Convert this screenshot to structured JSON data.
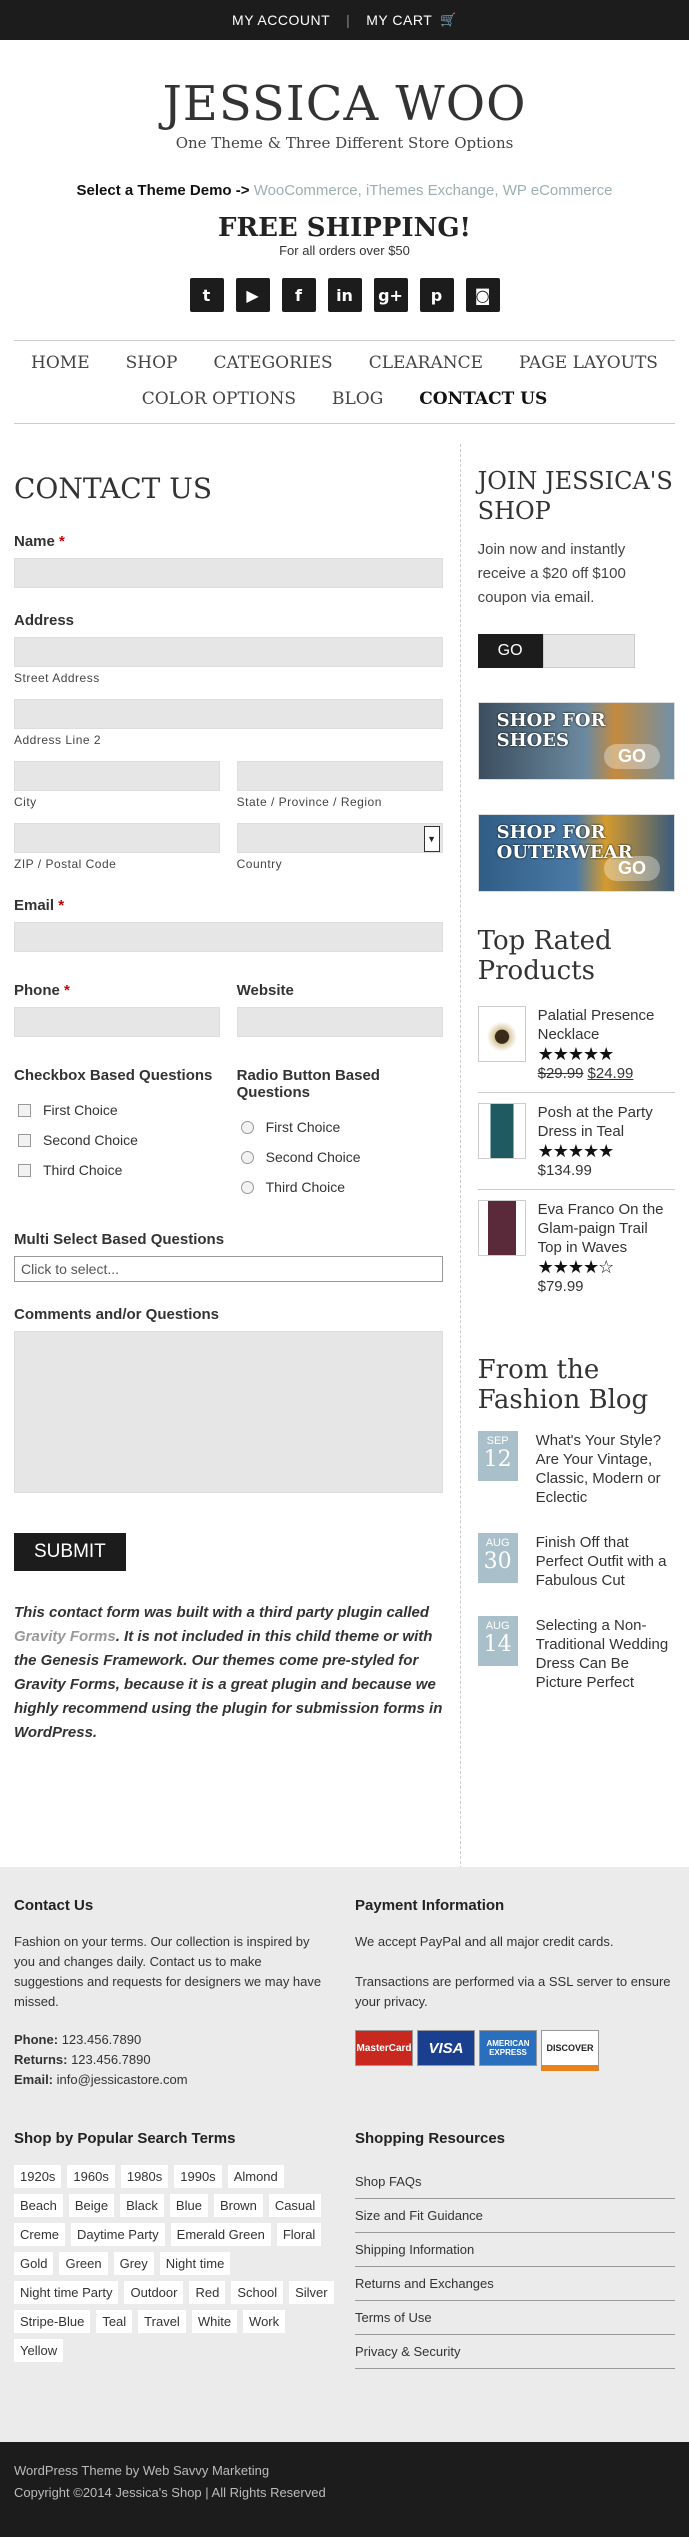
{
  "topbar": {
    "account": "MY ACCOUNT",
    "cart": "MY CART"
  },
  "header": {
    "title": "JESSICA WOO",
    "tagline": "One Theme & Three Different Store Options",
    "demo_label": "Select a Theme Demo ->",
    "demo_links": [
      "WooCommerce",
      "iThemes Exchange",
      "WP eCommerce"
    ],
    "shipping_title": "FREE SHIPPING!",
    "shipping_sub": "For all orders over $50",
    "social": [
      "twitter-icon",
      "youtube-icon",
      "facebook-icon",
      "linkedin-icon",
      "googleplus-icon",
      "pinterest-icon",
      "instagram-icon"
    ]
  },
  "nav": {
    "row1": [
      "HOME",
      "SHOP",
      "CATEGORIES",
      "CLEARANCE",
      "PAGE LAYOUTS"
    ],
    "row2": [
      "COLOR OPTIONS",
      "BLOG",
      "CONTACT US"
    ]
  },
  "form": {
    "title": "CONTACT US",
    "name_label": "Name",
    "address_label": "Address",
    "street": "Street Address",
    "line2": "Address Line 2",
    "city": "City",
    "state": "State / Province / Region",
    "zip": "ZIP / Postal Code",
    "country": "Country",
    "email_label": "Email",
    "phone_label": "Phone",
    "website_label": "Website",
    "checkbox_label": "Checkbox Based Questions",
    "checkbox_choices": [
      "First Choice",
      "Second Choice",
      "Third Choice"
    ],
    "radio_label": "Radio Button Based Questions",
    "radio_choices": [
      "First Choice",
      "Second Choice",
      "Third Choice"
    ],
    "multi_label": "Multi Select Based Questions",
    "multi_placeholder": "Click to select...",
    "comments_label": "Comments and/or Questions",
    "submit": "SUBMIT",
    "note_a": "This contact form was built with a third party plugin called ",
    "note_link": "Gravity Forms",
    "note_b": ".  It is not included in this child theme or with the Genesis Framework. Our themes come pre-styled for Gravity Forms, because it is a great plugin and because we highly recommend using the plugin for submission forms in WordPress."
  },
  "sidebar": {
    "join_title": "JOIN JESSICA'S SHOP",
    "join_text": "Join now and instantly receive a $20 off $100 coupon via email.",
    "go": "GO",
    "promo1": "SHOP FOR SHOES",
    "promo2": "SHOP FOR OUTERWEAR",
    "promo_go": "GO",
    "top_title": "Top Rated Products",
    "products": [
      {
        "name": "Palatial Presence Necklace",
        "stars": "★★★★★",
        "old_price": "$29.99",
        "price": "$24.99"
      },
      {
        "name": "Posh at the Party Dress in Teal",
        "stars": "★★★★★",
        "price": "$134.99"
      },
      {
        "name": "Eva Franco On the Glam-paign Trail Top in Waves",
        "stars": "★★★★☆",
        "price": "$79.99"
      }
    ],
    "blog_title": "From the Fashion Blog",
    "posts": [
      {
        "month": "SEP",
        "day": "12",
        "title": "What's Your Style? Are Your Vintage, Classic, Modern or Eclectic"
      },
      {
        "month": "AUG",
        "day": "30",
        "title": "Finish Off that Perfect Outfit with a Fabulous Cut"
      },
      {
        "month": "AUG",
        "day": "14",
        "title": "Selecting a Non-Traditional Wedding Dress Can Be Picture Perfect"
      }
    ]
  },
  "footer": {
    "contact_title": "Contact Us",
    "contact_text": "Fashion on your terms. Our collection is inspired by you and changes daily. Contact us to make suggestions and requests for designers we may have missed.",
    "phone_label": "Phone:",
    "phone": "123.456.7890",
    "returns_label": "Returns:",
    "returns": "123.456.7890",
    "email_label": "Email:",
    "email": "info@jessicastore.com",
    "payment_title": "Payment Information",
    "payment_text1": "We accept PayPal and all major credit cards.",
    "payment_text2": "Transactions are performed via a SSL server to ensure your privacy.",
    "cards": [
      "MasterCard",
      "VISA",
      "AMERICAN EXPRESS",
      "DISCOVER"
    ],
    "tags_title": "Shop by Popular Search Terms",
    "tags": [
      "1920s",
      "1960s",
      "1980s",
      "1990s",
      "Almond",
      "Beach",
      "Beige",
      "Black",
      "Blue",
      "Brown",
      "Casual",
      "Creme",
      "Daytime Party",
      "Emerald Green",
      "Floral",
      "Gold",
      "Green",
      "Grey",
      "Night time",
      "Night time Party",
      "Outdoor",
      "Red",
      "School",
      "Silver",
      "Stripe-Blue",
      "Teal",
      "Travel",
      "White",
      "Work",
      "Yellow"
    ],
    "resources_title": "Shopping Resources",
    "resources": [
      "Shop FAQs",
      "Size and Fit Guidance",
      "Shipping Information",
      "Returns and Exchanges",
      "Terms of Use",
      "Privacy & Security"
    ],
    "credit1": "WordPress Theme by Web Savvy Marketing",
    "credit2": "Copyright ©2014 Jessica's Shop | All Rights Reserved"
  }
}
